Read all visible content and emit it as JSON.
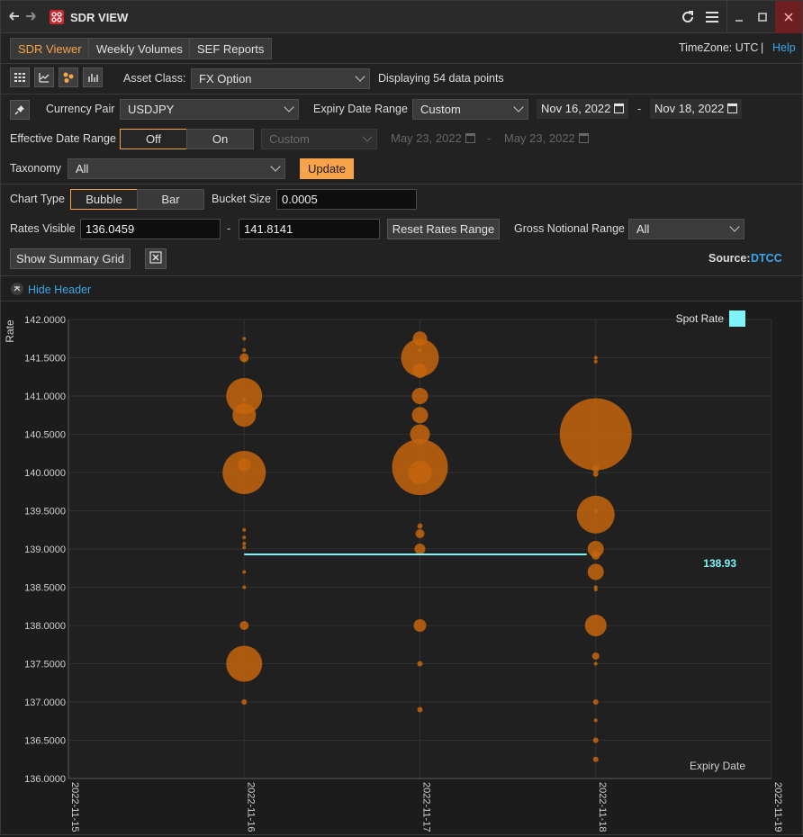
{
  "window": {
    "title": "SDR VIEW"
  },
  "tabs": [
    {
      "label": "SDR Viewer",
      "active": true
    },
    {
      "label": "Weekly Volumes",
      "active": false
    },
    {
      "label": "SEF Reports",
      "active": false
    }
  ],
  "header_right": {
    "timezone": "TimeZone: UTC",
    "separator": "|",
    "help": "Help"
  },
  "toolbar": {
    "asset_class_label": "Asset Class:",
    "asset_class_value": "FX Option",
    "displaying_text": "Displaying 54 data points"
  },
  "filters": {
    "currency_pair_label": "Currency Pair",
    "currency_pair_value": "USDJPY",
    "expiry_range_label": "Expiry Date Range",
    "expiry_range_value": "Custom",
    "expiry_from": "Nov 16, 2022",
    "expiry_dash": "-",
    "expiry_to": "Nov 18, 2022",
    "effective_label": "Effective Date Range",
    "effective_off": "Off",
    "effective_on": "On",
    "effective_select": "Custom",
    "effective_from": "May 23, 2022",
    "effective_dash": "-",
    "effective_to": "May 23, 2022",
    "taxonomy_label": "Taxonomy",
    "taxonomy_value": "All",
    "update_label": "Update"
  },
  "chart_controls": {
    "chart_type_label": "Chart Type",
    "bubble": "Bubble",
    "bar": "Bar",
    "bucket_size_label": "Bucket Size",
    "bucket_size_value": "0.0005",
    "rates_visible_label": "Rates Visible",
    "rates_from": "136.0459",
    "rates_dash": "-",
    "rates_to": "141.8141",
    "reset_rates": "Reset Rates Range",
    "gross_notional_label": "Gross Notional Range",
    "gross_notional_value": "All",
    "summary_grid": "Show Summary Grid",
    "source_label": "Source:",
    "source_value": "DTCC"
  },
  "hide_header": "Hide Header",
  "colors": {
    "accent": "#f7a34a",
    "bubble": "#c4650e",
    "spot": "#7ff4f7",
    "link": "#39a8ea"
  },
  "chart_data": {
    "type": "scatter",
    "ylabel": "Rate",
    "xlabel": "Expiry Date",
    "x_ticks": [
      "2022-11-15",
      "2022-11-16",
      "2022-11-17",
      "2022-11-18",
      "2022-11-19"
    ],
    "y_ticks": [
      "142.0000",
      "141.5000",
      "141.0000",
      "140.5000",
      "140.0000",
      "139.5000",
      "139.0000",
      "138.5000",
      "138.0000",
      "137.5000",
      "137.0000",
      "136.5000",
      "136.0000"
    ],
    "ylim": [
      136,
      142
    ],
    "legend": {
      "label": "Spot Rate",
      "position": "top-right"
    },
    "spot_rate": {
      "value": 138.93,
      "label": "138.93",
      "x_from": "2022-11-16",
      "x_to": "2022-11-18"
    },
    "series": [
      {
        "date": "2022-11-16",
        "points": [
          {
            "rate": 141.75,
            "r": 2
          },
          {
            "rate": 141.6,
            "r": 2
          },
          {
            "rate": 141.5,
            "r": 5
          },
          {
            "rate": 141.47,
            "r": 2
          },
          {
            "rate": 141.0,
            "r": 20
          },
          {
            "rate": 140.95,
            "r": 2
          },
          {
            "rate": 140.75,
            "r": 13
          },
          {
            "rate": 140.1,
            "r": 7
          },
          {
            "rate": 140.0,
            "r": 24
          },
          {
            "rate": 139.25,
            "r": 2
          },
          {
            "rate": 139.15,
            "r": 2
          },
          {
            "rate": 139.07,
            "r": 2
          },
          {
            "rate": 139.02,
            "r": 2
          },
          {
            "rate": 138.7,
            "r": 2
          },
          {
            "rate": 138.5,
            "r": 2
          },
          {
            "rate": 138.0,
            "r": 5
          },
          {
            "rate": 137.5,
            "r": 20
          },
          {
            "rate": 137.0,
            "r": 3
          }
        ]
      },
      {
        "date": "2022-11-17",
        "points": [
          {
            "rate": 141.75,
            "r": 8
          },
          {
            "rate": 141.6,
            "r": 2
          },
          {
            "rate": 141.5,
            "r": 21
          },
          {
            "rate": 141.33,
            "r": 8
          },
          {
            "rate": 141.0,
            "r": 9
          },
          {
            "rate": 140.75,
            "r": 9
          },
          {
            "rate": 140.5,
            "r": 11
          },
          {
            "rate": 140.07,
            "r": 31
          },
          {
            "rate": 140.0,
            "r": 13
          },
          {
            "rate": 139.3,
            "r": 3
          },
          {
            "rate": 139.2,
            "r": 5
          },
          {
            "rate": 139.0,
            "r": 6
          },
          {
            "rate": 138.0,
            "r": 7
          },
          {
            "rate": 137.5,
            "r": 3
          },
          {
            "rate": 136.9,
            "r": 3
          }
        ]
      },
      {
        "date": "2022-11-18",
        "points": [
          {
            "rate": 141.5,
            "r": 2
          },
          {
            "rate": 141.45,
            "r": 2
          },
          {
            "rate": 140.5,
            "r": 40
          },
          {
            "rate": 140.05,
            "r": 4
          },
          {
            "rate": 139.98,
            "r": 3
          },
          {
            "rate": 139.45,
            "r": 21
          },
          {
            "rate": 139.5,
            "r": 2
          },
          {
            "rate": 139.0,
            "r": 9
          },
          {
            "rate": 138.92,
            "r": 5
          },
          {
            "rate": 138.7,
            "r": 9
          },
          {
            "rate": 138.5,
            "r": 2
          },
          {
            "rate": 138.47,
            "r": 2
          },
          {
            "rate": 138.0,
            "r": 12
          },
          {
            "rate": 137.6,
            "r": 4
          },
          {
            "rate": 137.5,
            "r": 2
          },
          {
            "rate": 137.0,
            "r": 3
          },
          {
            "rate": 136.76,
            "r": 2
          },
          {
            "rate": 136.5,
            "r": 3
          },
          {
            "rate": 136.25,
            "r": 3
          }
        ]
      }
    ]
  }
}
